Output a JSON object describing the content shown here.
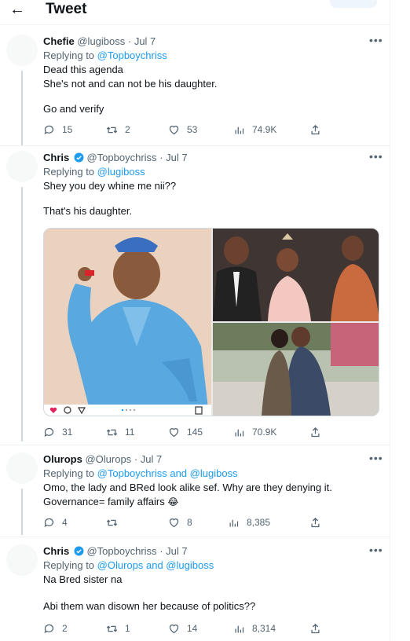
{
  "header": {
    "back_label": "←",
    "title": "Tweet"
  },
  "tweets": [
    {
      "author": "Chefie",
      "handle": "@lugiboss",
      "date": "· Jul 7",
      "verified": false,
      "replying_prefix": "Replying to",
      "replying_to": "@Topboychriss",
      "text_lines": [
        "Dead this agenda",
        "She's not and can not be his daughter.",
        "",
        "Go and verify"
      ],
      "stats": {
        "replies": "15",
        "retweets": "2",
        "likes": "53",
        "views": "74.9K"
      }
    },
    {
      "author": "Chris",
      "handle": "@Topboychriss",
      "date": "· Jul 7",
      "verified": true,
      "replying_prefix": "Replying to",
      "replying_to": "@lugiboss",
      "text_lines": [
        "Shey you dey whine me nii??",
        "",
        "That's his daughter."
      ],
      "stats": {
        "replies": "31",
        "retweets": "11",
        "likes": "145",
        "views": "70.9K"
      }
    },
    {
      "author": "Olurops",
      "handle": "@Olurops",
      "date": "· Jul 7",
      "verified": false,
      "replying_prefix": "Replying to",
      "replying_to": "@Topboychriss and @lugiboss",
      "text_lines": [
        "Omo, the lady and BRed look alike sef. Why are they denying it.",
        "Governance= family affairs"
      ],
      "emoji": "😂",
      "stats": {
        "replies": "4",
        "retweets": "",
        "likes": "8",
        "views": "8,385"
      }
    },
    {
      "author": "Chris",
      "handle": "@Topboychriss",
      "date": "· Jul 7",
      "verified": true,
      "replying_prefix": "Replying to",
      "replying_to": "@Olurops and @lugiboss",
      "text_lines": [
        "Na Bred sister na",
        "",
        "Abi them wan disown her because of politics??"
      ],
      "stats": {
        "replies": "2",
        "retweets": "1",
        "likes": "14",
        "views": "8,314"
      }
    }
  ],
  "more_label": "•••",
  "icons": {
    "reply": "reply-icon",
    "retweet": "retweet-icon",
    "like": "like-icon",
    "views": "views-icon",
    "share": "share-icon",
    "verified": "verified-badge-icon"
  },
  "colors": {
    "link": "#1d9bf0",
    "muted": "#536471",
    "text": "#0f1419",
    "verified": "#1d9bf0"
  }
}
